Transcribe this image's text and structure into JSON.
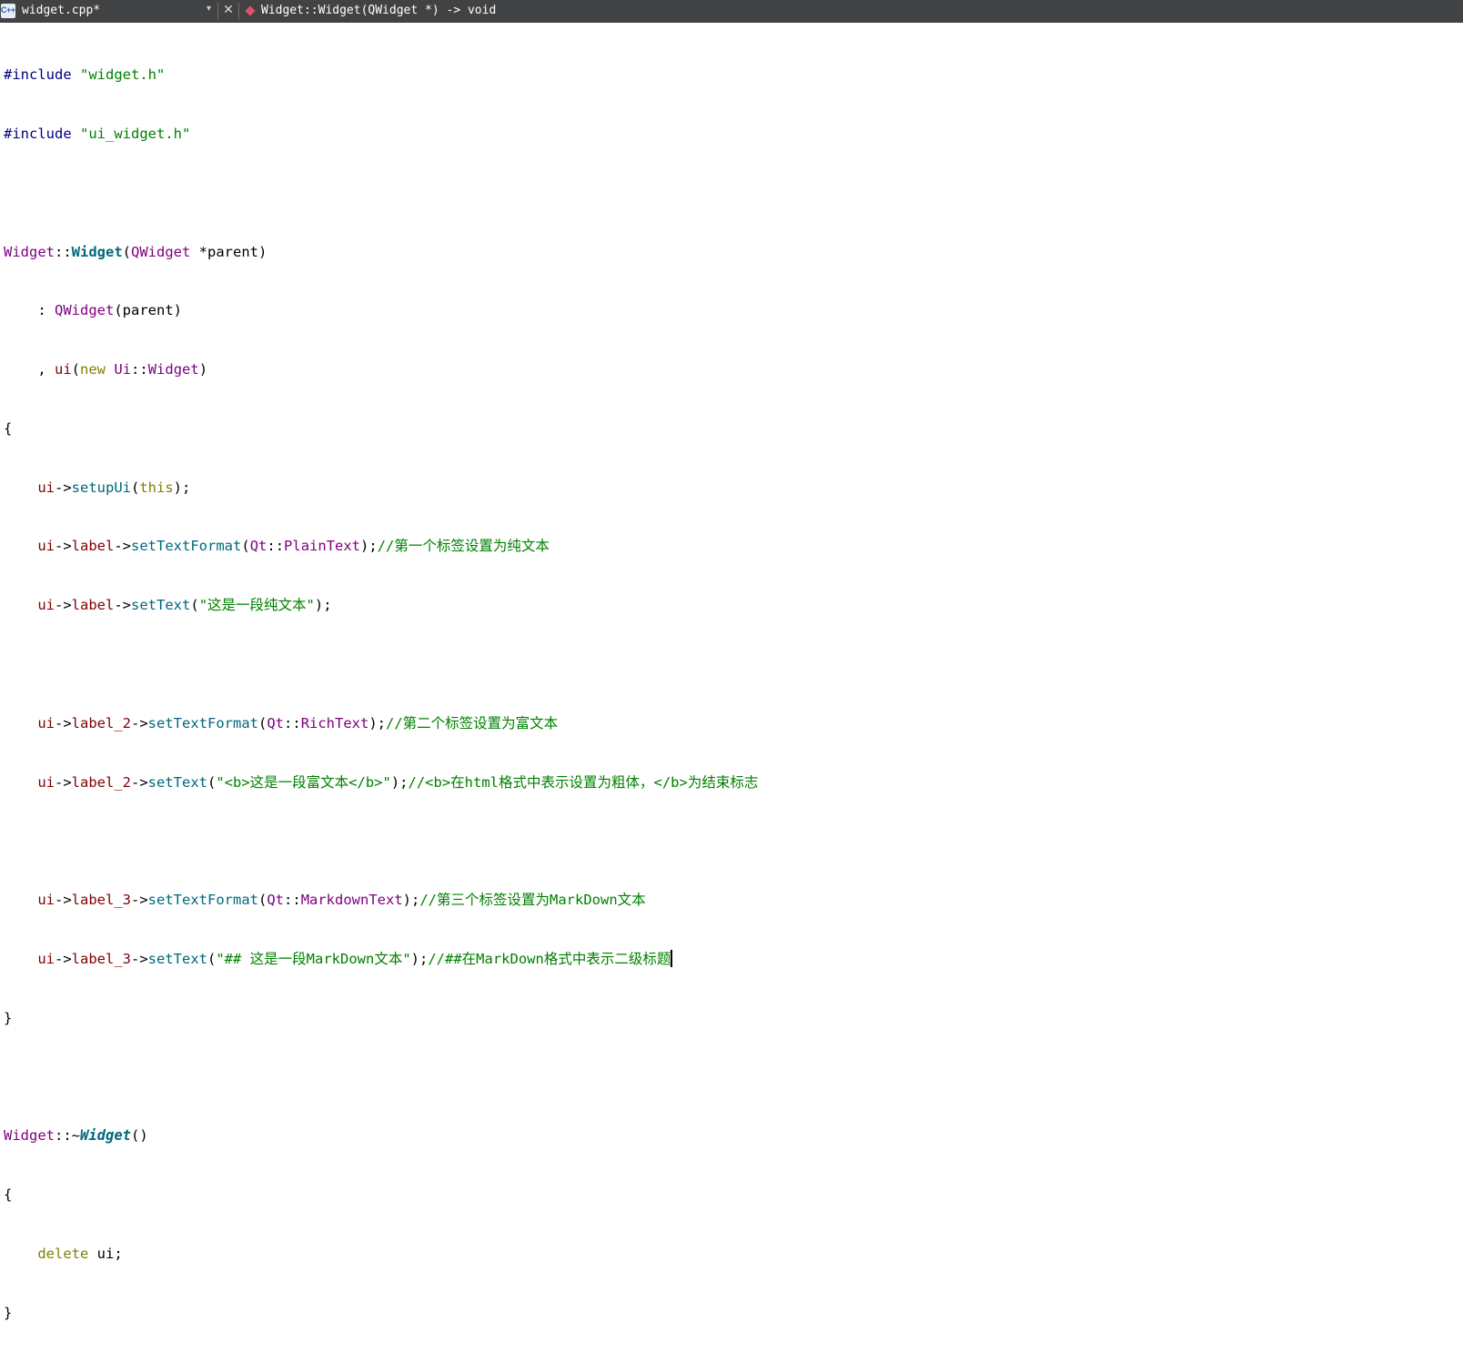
{
  "editor_toolbar": {
    "file_icon_label": "C++",
    "file_name": "widget.cpp*",
    "dropdown_glyph": "▾",
    "close_glyph": "✕",
    "symbol_text": "Widget::Widget(QWidget *) -> void"
  },
  "code": {
    "l1_kw": "#include",
    "l1_str": "\"widget.h\"",
    "l2_kw": "#include",
    "l2_str": "\"ui_widget.h\"",
    "l4_class": "Widget",
    "l4_sep": "::",
    "l4_ctor": "Widget",
    "l4_open": "(",
    "l4_type": "QWidget",
    "l4_param": " *parent)",
    "l5_indent": "    : ",
    "l5_type": "QWidget",
    "l5_args": "(parent)",
    "l6_indent": "    , ",
    "l6_mem": "ui",
    "l6_open": "(",
    "l6_kw": "new",
    "l6_sp": " ",
    "l6_ns": "Ui",
    "l6_sep": "::",
    "l6_type": "Widget",
    "l6_close": ")",
    "l7": "{",
    "l8_indent": "    ",
    "l8_mem": "ui",
    "l8_arrow": "->",
    "l8_fn": "setupUi",
    "l8_open": "(",
    "l8_kw": "this",
    "l8_close": ");",
    "l9_indent": "    ",
    "l9_mem1": "ui",
    "l9_arrow1": "->",
    "l9_mem2": "label",
    "l9_arrow2": "->",
    "l9_fn": "setTextFormat",
    "l9_open": "(",
    "l9_ns": "Qt",
    "l9_sep": "::",
    "l9_enum": "PlainText",
    "l9_close": ");",
    "l9_cmt": "//第一个标签设置为纯文本",
    "l10_indent": "    ",
    "l10_mem1": "ui",
    "l10_arrow1": "->",
    "l10_mem2": "label",
    "l10_arrow2": "->",
    "l10_fn": "setText",
    "l10_open": "(",
    "l10_str": "\"这是一段纯文本\"",
    "l10_close": ");",
    "l12_indent": "    ",
    "l12_mem1": "ui",
    "l12_arrow1": "->",
    "l12_mem2": "label_2",
    "l12_arrow2": "->",
    "l12_fn": "setTextFormat",
    "l12_open": "(",
    "l12_ns": "Qt",
    "l12_sep": "::",
    "l12_enum": "RichText",
    "l12_close": ");",
    "l12_cmt": "//第二个标签设置为富文本",
    "l13_indent": "    ",
    "l13_mem1": "ui",
    "l13_arrow1": "->",
    "l13_mem2": "label_2",
    "l13_arrow2": "->",
    "l13_fn": "setText",
    "l13_open": "(",
    "l13_str": "\"<b>这是一段富文本</b>\"",
    "l13_close": ");",
    "l13_cmt": "//<b>在html格式中表示设置为粗体，</b>为结束标志",
    "l15_indent": "    ",
    "l15_mem1": "ui",
    "l15_arrow1": "->",
    "l15_mem2": "label_3",
    "l15_arrow2": "->",
    "l15_fn": "setTextFormat",
    "l15_open": "(",
    "l15_ns": "Qt",
    "l15_sep": "::",
    "l15_enum": "MarkdownText",
    "l15_close": ");",
    "l15_cmt": "//第三个标签设置为MarkDown文本",
    "l16_indent": "    ",
    "l16_mem1": "ui",
    "l16_arrow1": "->",
    "l16_mem2": "label_3",
    "l16_arrow2": "->",
    "l16_fn": "setText",
    "l16_open": "(",
    "l16_str": "\"## 这是一段MarkDown文本\"",
    "l16_close": ");",
    "l16_cmt": "//##在MarkDown格式中表示二级标题",
    "l17": "}",
    "l19_class": "Widget",
    "l19_sep": "::~",
    "l19_dtor": "Widget",
    "l19_paren": "()",
    "l20": "{",
    "l21_indent": "    ",
    "l21_kw": "delete",
    "l21_rest": " ui;",
    "l22": "}"
  }
}
